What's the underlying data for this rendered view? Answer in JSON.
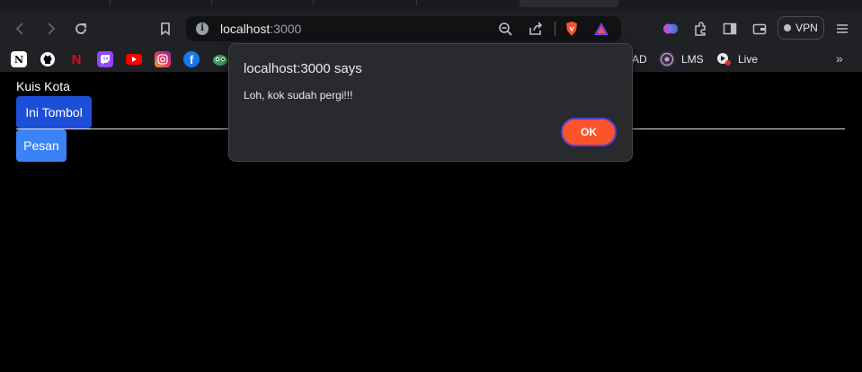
{
  "browser": {
    "url_host": "localhost",
    "url_port": ":3000",
    "vpn_label": "VPN",
    "bookmarks": [
      {
        "icon": "notion-icon"
      },
      {
        "icon": "github-icon"
      },
      {
        "icon": "netflix-icon"
      },
      {
        "icon": "twitch-icon"
      },
      {
        "icon": "youtube-icon"
      },
      {
        "icon": "instagram-icon"
      },
      {
        "icon": "facebook-icon"
      },
      {
        "icon": "owl-icon"
      },
      {
        "partial_label": "AD"
      },
      {
        "icon": "lms-icon",
        "label": "LMS"
      },
      {
        "icon": "live-icon",
        "label": "Live"
      }
    ]
  },
  "page": {
    "title": "Kuis Kota",
    "primary_button": "Ini Tombol",
    "secondary_button": "Pesan"
  },
  "dialog": {
    "title": "localhost:3000 says",
    "message": "Loh, kok sudah pergi!!!",
    "ok_label": "OK"
  },
  "colors": {
    "brave_accent": "#fb542b",
    "primary_button": "#1d4ed8",
    "secondary_button": "#3b82f6"
  }
}
